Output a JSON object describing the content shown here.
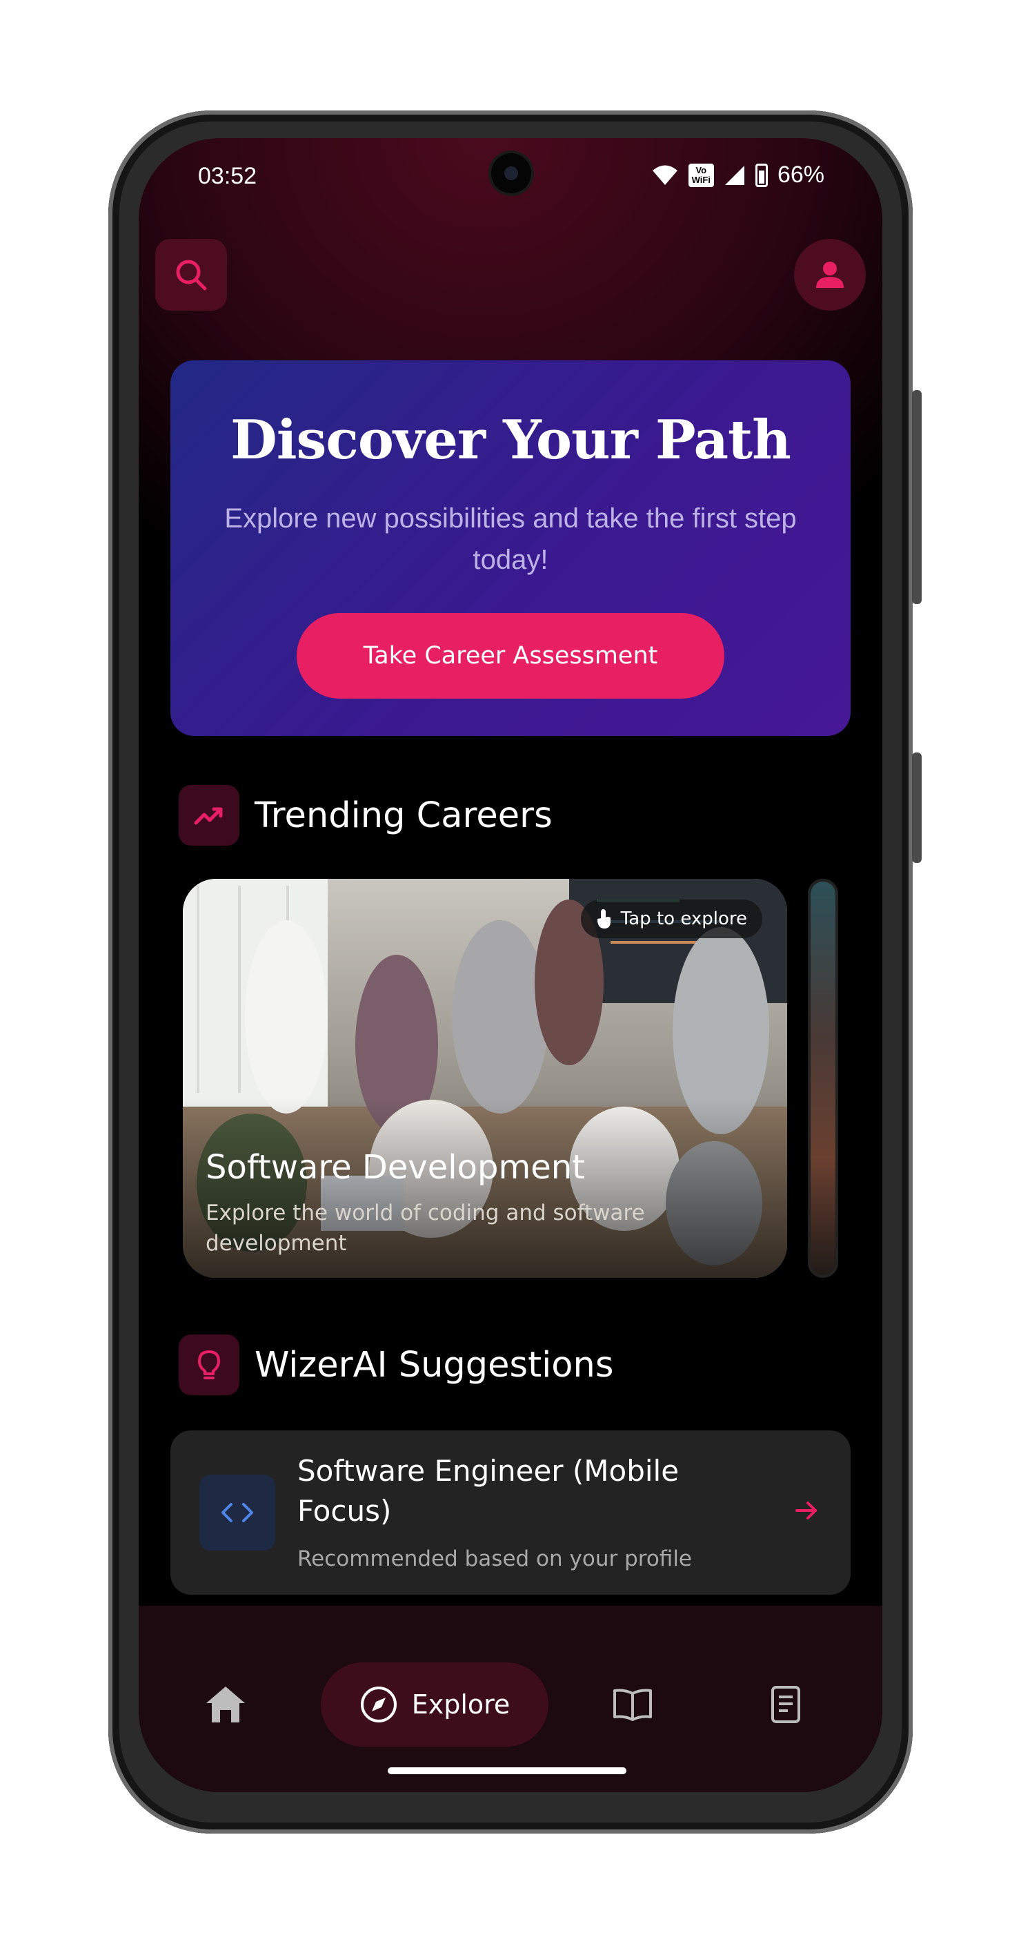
{
  "status_bar": {
    "time": "03:52",
    "vowifi": "Vo WiFi",
    "battery": "66%"
  },
  "hero": {
    "title": "Discover Your Path",
    "subtitle": "Explore new possibilities and take the first step today!",
    "cta_label": "Take Career Assessment"
  },
  "trending": {
    "title": "Trending Careers",
    "cards": [
      {
        "tap_hint": "Tap to explore",
        "title": "Software Development",
        "description": "Explore the world of coding and software development"
      }
    ]
  },
  "suggestions": {
    "title": "WizerAI Suggestions",
    "items": [
      {
        "title": "Software Engineer (Mobile Focus)",
        "subtitle": "Recommended based on your profile"
      }
    ]
  },
  "nav": {
    "explore_label": "Explore"
  },
  "colors": {
    "accent": "#e81f63",
    "hero_start": "#222885",
    "hero_end": "#461896",
    "nav_bg": "#1c0a10"
  },
  "icons": [
    "search-icon",
    "profile-icon",
    "trending-up-icon",
    "lightbulb-icon",
    "tap-icon",
    "code-icon",
    "arrow-right-icon",
    "home-icon",
    "compass-icon",
    "book-icon",
    "document-icon"
  ]
}
